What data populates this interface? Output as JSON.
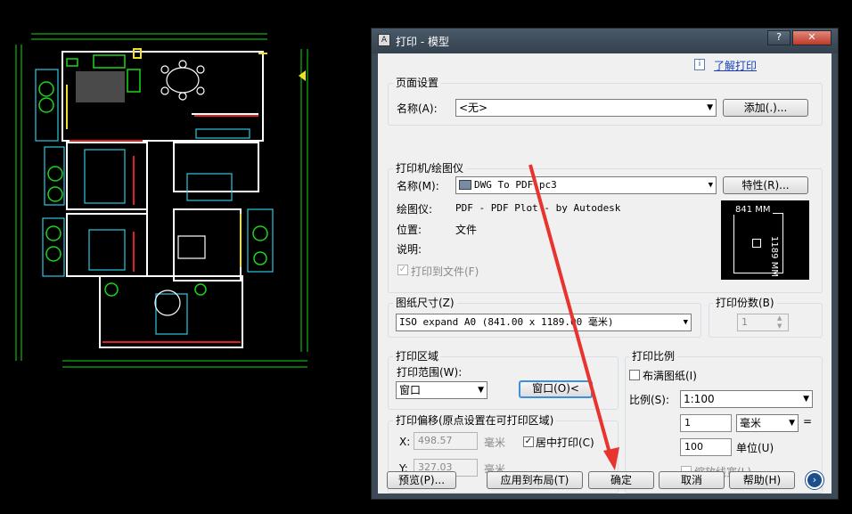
{
  "window": {
    "title": "打印 - 模型",
    "help_link": "了解打印"
  },
  "page_setup": {
    "group_label": "页面设置",
    "name_label": "名称(A):",
    "name_value": "<无>",
    "add_button": "添加(.)..."
  },
  "printer": {
    "group_label": "打印机/绘图仪",
    "name_label": "名称(M):",
    "name_value": "DWG To PDF.pc3",
    "properties_button": "特性(R)...",
    "plotter_label": "绘图仪:",
    "plotter_value": "PDF - PDF Plot - by Autodesk",
    "location_label": "位置:",
    "location_value": "文件",
    "description_label": "说明:",
    "print_to_file_label": "打印到文件(F)",
    "preview_width": "841 MM",
    "preview_height": "1189 MM"
  },
  "paper": {
    "group_label": "图纸尺寸(Z)",
    "value": "ISO expand A0 (841.00 x 1189.00 毫米)"
  },
  "copies": {
    "group_label": "打印份数(B)",
    "value": "1"
  },
  "area": {
    "group_label": "打印区域",
    "range_label": "打印范围(W):",
    "range_value": "窗口",
    "window_button": "窗口(O)<"
  },
  "offset": {
    "group_label": "打印偏移(原点设置在可打印区域)",
    "x_label": "X:",
    "x_value": "498.57",
    "x_unit": "毫米",
    "y_label": "Y:",
    "y_value": "327.03",
    "y_unit": "毫米",
    "center_label": "居中打印(C)"
  },
  "scale": {
    "group_label": "打印比例",
    "fit_label": "布满图纸(I)",
    "ratio_label": "比例(S):",
    "ratio_value": "1:100",
    "value1": "1",
    "unit_value": "毫米",
    "equals": "=",
    "value2": "100",
    "unit_label": "单位(U)",
    "lineweight_label": "缩放线宽(L)"
  },
  "buttons": {
    "preview": "预览(P)...",
    "apply": "应用到布局(T)",
    "ok": "确定",
    "cancel": "取消",
    "help": "帮助(H)"
  },
  "colors": {
    "accent_arrow": "#e8342e",
    "cad_green": "#18d818",
    "cad_white": "#ffffff"
  }
}
